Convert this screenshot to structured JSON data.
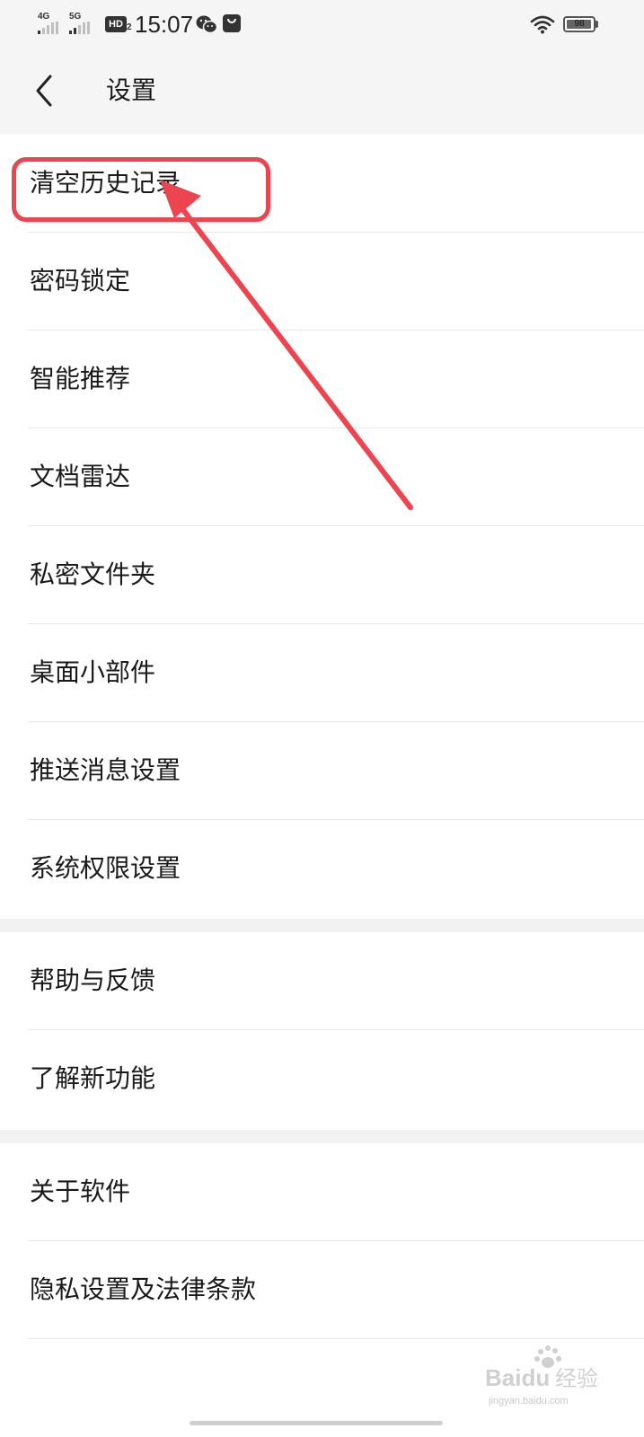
{
  "status_bar": {
    "signal_1_label": "4G",
    "signal_2_label": "5G",
    "hd_badge": "HD",
    "hd_sub": "2",
    "time": "15:07",
    "battery_percent": "98",
    "battery_level": 0.98
  },
  "header": {
    "title": "设置"
  },
  "groups": [
    {
      "items": [
        {
          "label": "清空历史记录"
        },
        {
          "label": "密码锁定"
        },
        {
          "label": "智能推荐"
        },
        {
          "label": "文档雷达"
        },
        {
          "label": "私密文件夹"
        },
        {
          "label": "桌面小部件"
        },
        {
          "label": "推送消息设置"
        },
        {
          "label": "系统权限设置"
        }
      ]
    },
    {
      "items": [
        {
          "label": "帮助与反馈"
        },
        {
          "label": "了解新功能"
        }
      ]
    },
    {
      "items": [
        {
          "label": "关于软件"
        },
        {
          "label": "隐私设置及法律条款"
        }
      ]
    }
  ],
  "annotation": {
    "color": "#ec4550",
    "target_label": "清空历史记录"
  },
  "watermark": {
    "brand": "Baidu",
    "brand_cn": "经验",
    "domain": "jingyan.baidu.com"
  },
  "colors": {
    "header_bg": "#f5f5f5",
    "divider": "#e8e8e8",
    "section_gap": "#f2f2f2",
    "text": "#1a1a1a"
  }
}
